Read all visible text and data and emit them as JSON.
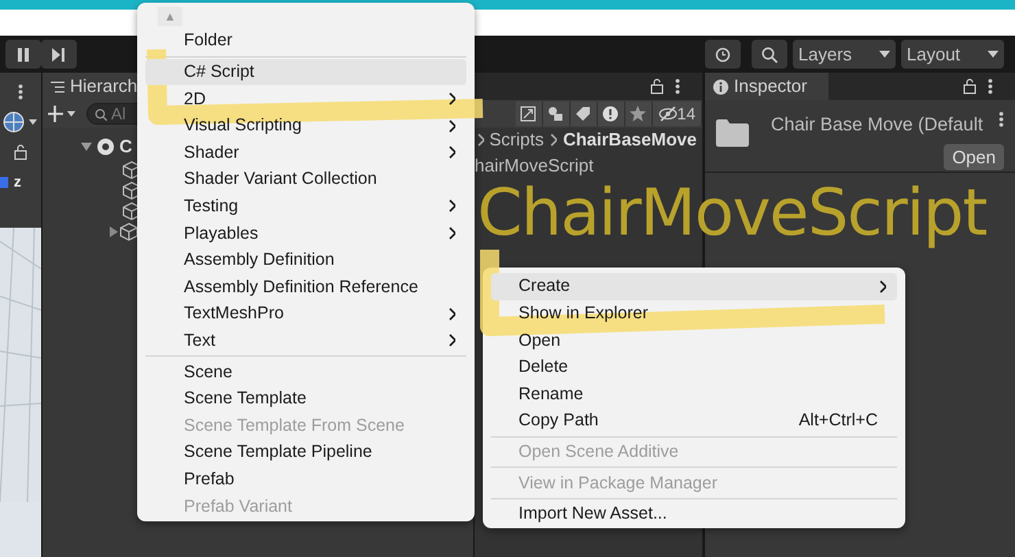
{
  "toolbar": {
    "dropdowns": [
      "Layers",
      "Layout"
    ]
  },
  "scene_view": {
    "axis_label": "z"
  },
  "hierarchy": {
    "tab": "Hierarch",
    "search": {
      "placeholder": "Al"
    },
    "tree": [
      {
        "label": "C",
        "expanded": true
      }
    ]
  },
  "project": {
    "hidden_count": "14",
    "breadcrumb": [
      "Scripts",
      "ChairBaseMove"
    ],
    "items": [
      "hairMoveScript"
    ]
  },
  "inspector": {
    "tab": "Inspector",
    "title": "Chair Base Move (Default",
    "button": "Open"
  },
  "context_menu": {
    "scroll_arrow": "▲",
    "sections": [
      [
        {
          "label": "Folder",
          "submenu": false,
          "disabled": false,
          "hovered": false
        }
      ],
      [
        {
          "label": "C# Script",
          "submenu": false,
          "disabled": false,
          "hovered": true
        },
        {
          "label": "2D",
          "submenu": true,
          "disabled": false,
          "hovered": false
        },
        {
          "label": "Visual Scripting",
          "submenu": true,
          "disabled": false,
          "hovered": false
        },
        {
          "label": "Shader",
          "submenu": true,
          "disabled": false,
          "hovered": false
        },
        {
          "label": "Shader Variant Collection",
          "submenu": false,
          "disabled": false,
          "hovered": false
        },
        {
          "label": "Testing",
          "submenu": true,
          "disabled": false,
          "hovered": false
        },
        {
          "label": "Playables",
          "submenu": true,
          "disabled": false,
          "hovered": false
        },
        {
          "label": "Assembly Definition",
          "submenu": false,
          "disabled": false,
          "hovered": false
        },
        {
          "label": "Assembly Definition Reference",
          "submenu": false,
          "disabled": false,
          "hovered": false
        },
        {
          "label": "TextMeshPro",
          "submenu": true,
          "disabled": false,
          "hovered": false
        },
        {
          "label": "Text",
          "submenu": true,
          "disabled": false,
          "hovered": false
        }
      ],
      [
        {
          "label": "Scene",
          "submenu": false,
          "disabled": false,
          "hovered": false
        },
        {
          "label": "Scene Template",
          "submenu": false,
          "disabled": false,
          "hovered": false
        },
        {
          "label": "Scene Template From Scene",
          "submenu": false,
          "disabled": true,
          "hovered": false
        },
        {
          "label": "Scene Template Pipeline",
          "submenu": false,
          "disabled": false,
          "hovered": false
        },
        {
          "label": "Prefab",
          "submenu": false,
          "disabled": false,
          "hovered": false
        },
        {
          "label": "Prefab Variant",
          "submenu": false,
          "disabled": true,
          "hovered": false
        }
      ]
    ]
  },
  "asset_menu": {
    "sections": [
      [
        {
          "label": "Create",
          "submenu": true,
          "disabled": false,
          "hovered": true
        },
        {
          "label": "Show in Explorer",
          "submenu": false,
          "disabled": false,
          "hovered": false
        },
        {
          "label": "Open",
          "submenu": false,
          "disabled": false,
          "hovered": false
        },
        {
          "label": "Delete",
          "submenu": false,
          "disabled": false,
          "hovered": false
        },
        {
          "label": "Rename",
          "submenu": false,
          "disabled": false,
          "hovered": false
        },
        {
          "label": "Copy Path",
          "submenu": false,
          "disabled": false,
          "hovered": false,
          "shortcut": "Alt+Ctrl+C"
        }
      ],
      [
        {
          "label": "Open Scene Additive",
          "submenu": false,
          "disabled": true,
          "hovered": false
        }
      ],
      [
        {
          "label": "View in Package Manager",
          "submenu": false,
          "disabled": true,
          "hovered": false
        }
      ],
      [
        {
          "label": "Import New Asset...",
          "submenu": false,
          "disabled": false,
          "hovered": false
        }
      ]
    ]
  },
  "annotation": {
    "text": "ChairMoveScript"
  }
}
